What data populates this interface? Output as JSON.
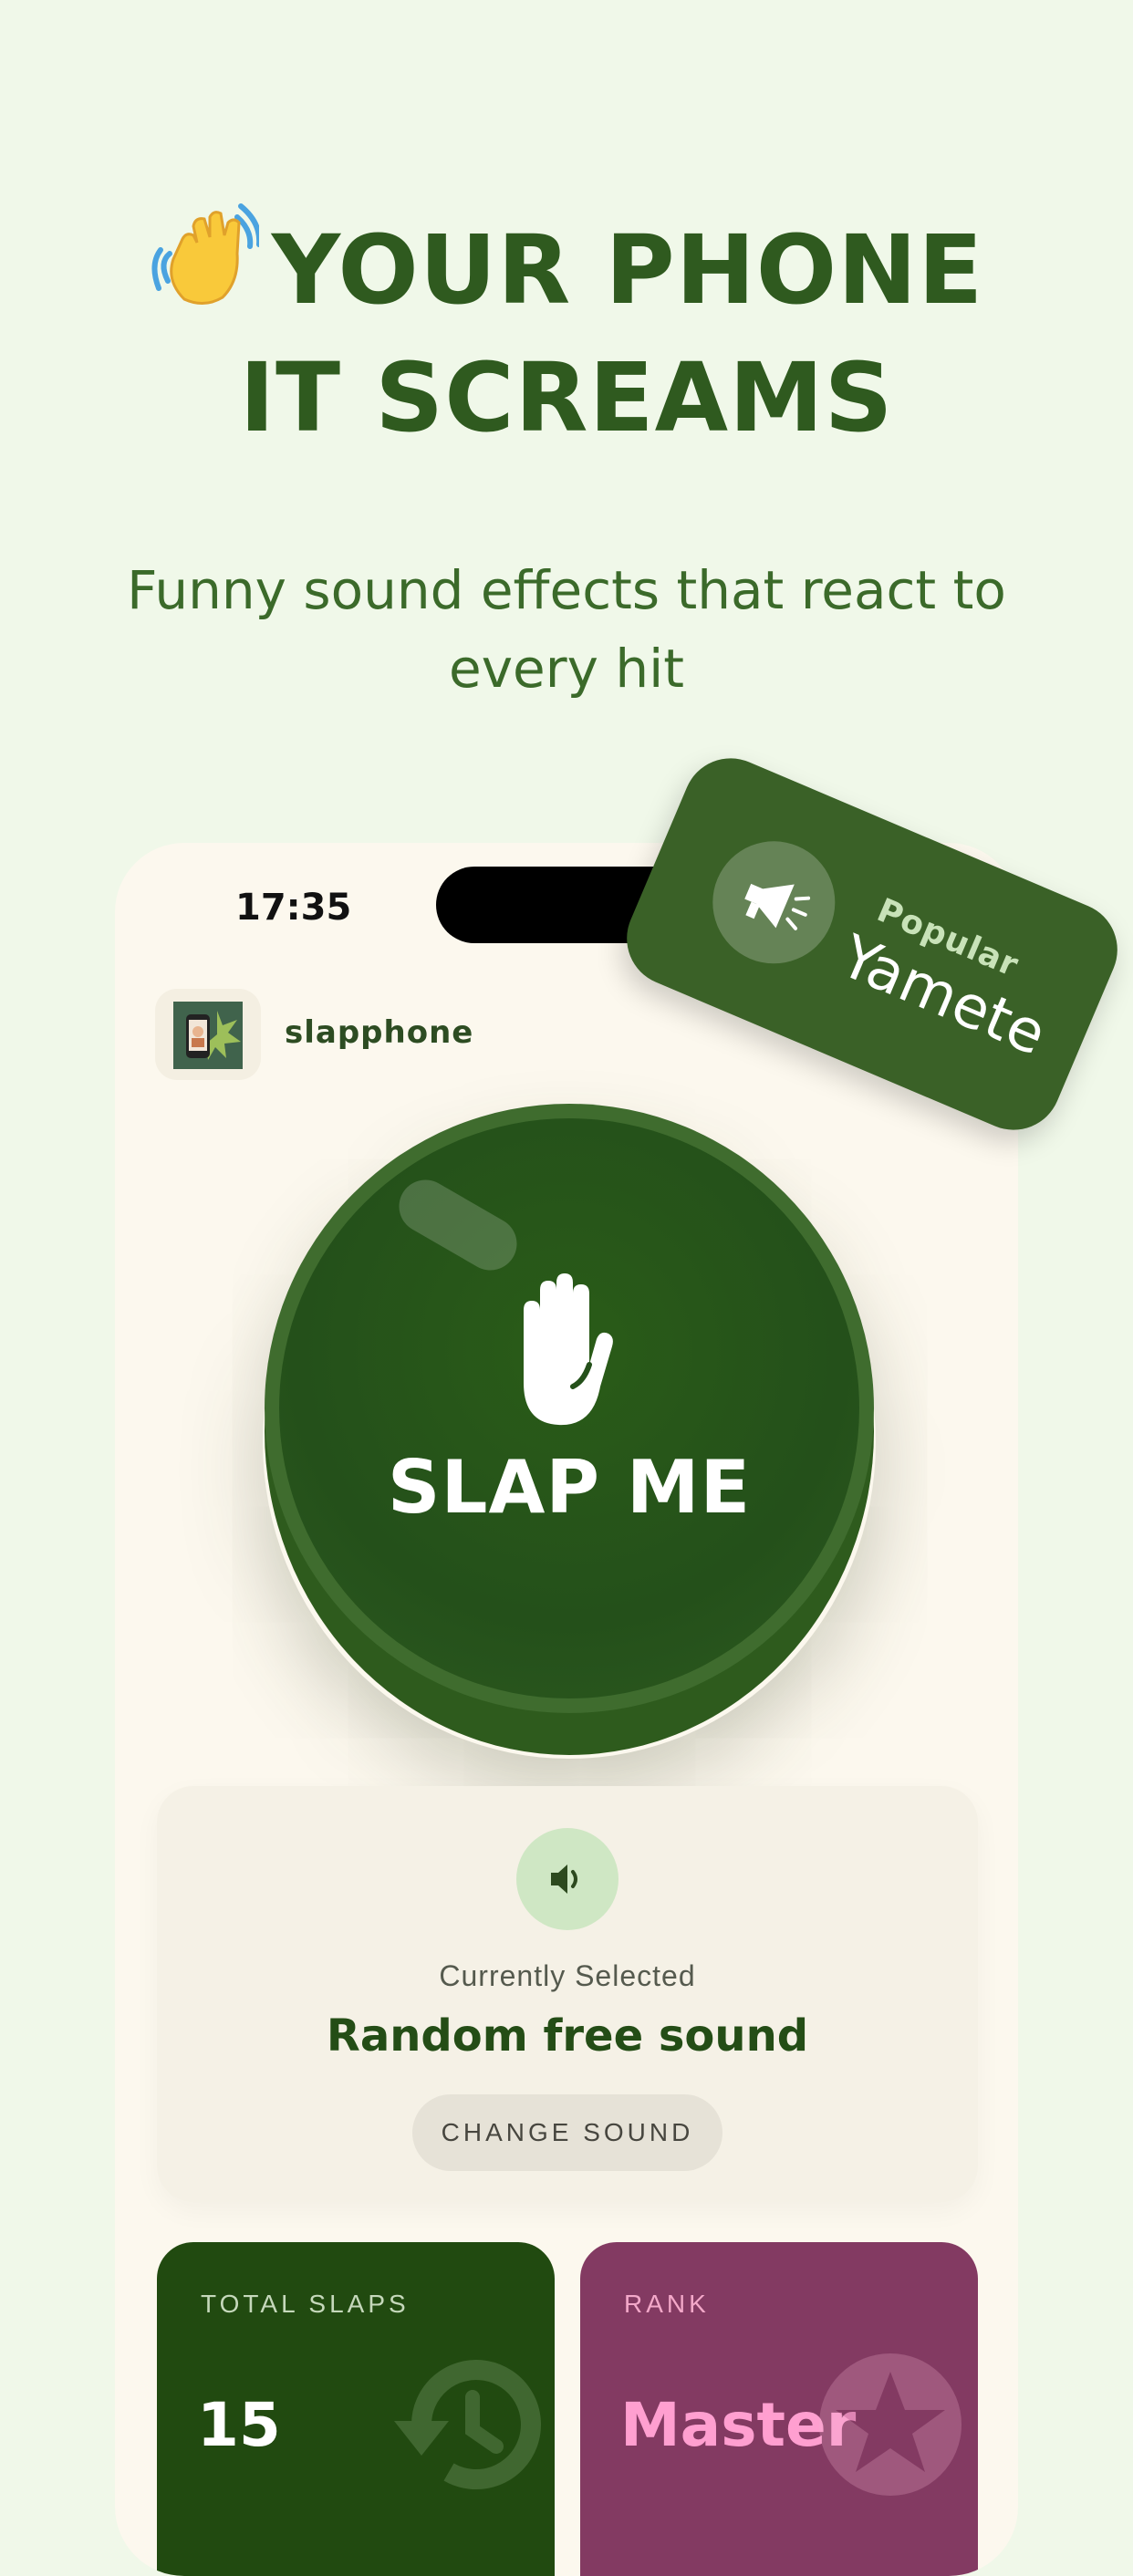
{
  "hero": {
    "line1": "YOUR PHONE",
    "line2": "IT SCREAMS",
    "subtitle": "Funny sound effects that react to every hit"
  },
  "status_bar": {
    "time": "17:35"
  },
  "app": {
    "name": "slapphone"
  },
  "slap_button": {
    "label": "SLAP ME"
  },
  "sound_card": {
    "caption": "Currently Selected",
    "selected_sound": "Random free sound",
    "change_button": "CHANGE SOUND"
  },
  "stats": {
    "total_label": "TOTAL SLAPS",
    "total_value": "15",
    "rank_label": "RANK",
    "rank_value": "Master"
  },
  "popular_card": {
    "label": "Popular",
    "name": "Yamete"
  },
  "colors": {
    "background": "#f0f8e9",
    "primary_green": "#2f5a1f",
    "rank_purple": "#833a62",
    "rank_pink": "#ff9fd0"
  },
  "icons": [
    "waving-hand-icon",
    "app-logo",
    "hand-icon",
    "speaker-icon",
    "history-icon",
    "star-badge-icon",
    "megaphone-icon"
  ]
}
